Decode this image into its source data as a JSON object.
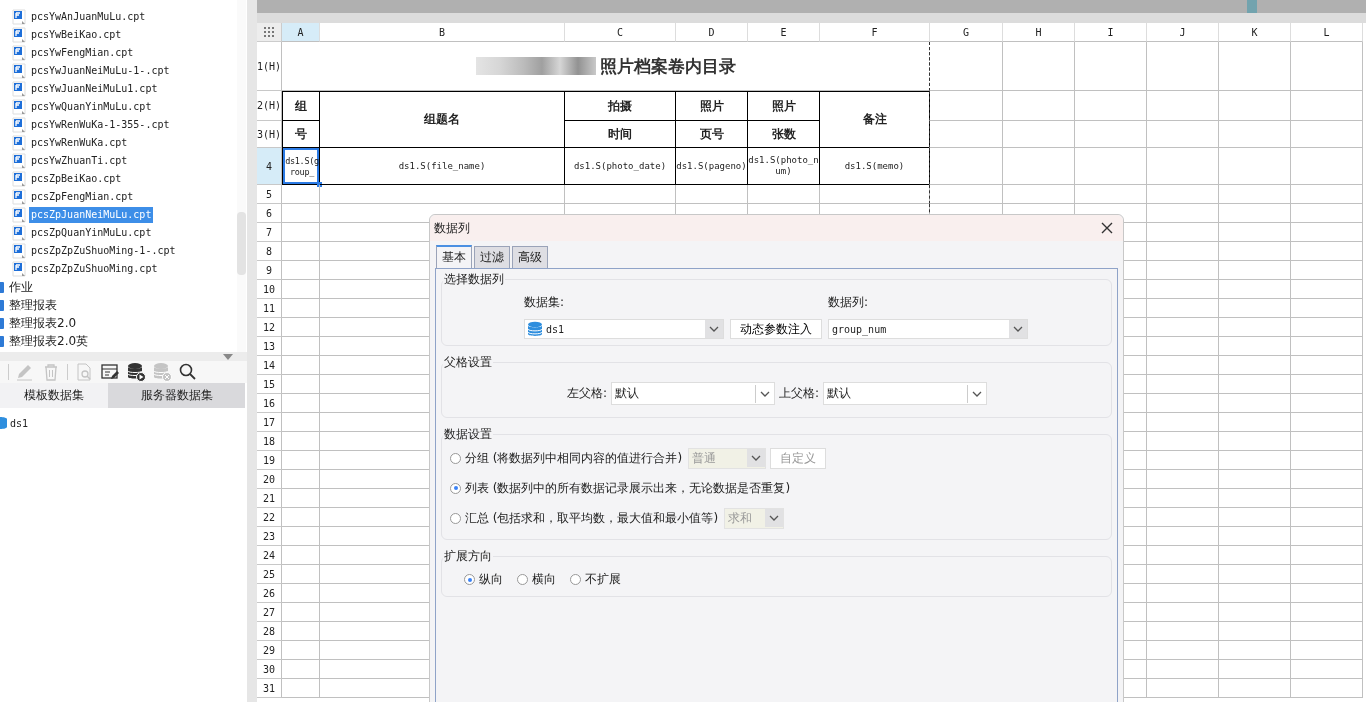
{
  "file_tree": {
    "files": [
      {
        "name": "pcsYwAnJuanMuLu.cpt",
        "selected": false
      },
      {
        "name": "pcsYwBeiKao.cpt",
        "selected": false
      },
      {
        "name": "pcsYwFengMian.cpt",
        "selected": false
      },
      {
        "name": "pcsYwJuanNeiMuLu-1-.cpt",
        "selected": false
      },
      {
        "name": "pcsYwJuanNeiMuLu1.cpt",
        "selected": false
      },
      {
        "name": "pcsYwQuanYinMuLu.cpt",
        "selected": false
      },
      {
        "name": "pcsYwRenWuKa-1-355-.cpt",
        "selected": false
      },
      {
        "name": "pcsYwRenWuKa.cpt",
        "selected": false
      },
      {
        "name": "pcsYwZhuanTi.cpt",
        "selected": false
      },
      {
        "name": "pcsZpBeiKao.cpt",
        "selected": false
      },
      {
        "name": "pcsZpFengMian.cpt",
        "selected": false
      },
      {
        "name": "pcsZpJuanNeiMuLu.cpt",
        "selected": true
      },
      {
        "name": "pcsZpQuanYinMuLu.cpt",
        "selected": false
      },
      {
        "name": "pcsZpZpZuShuoMing-1-.cpt",
        "selected": false
      },
      {
        "name": "pcsZpZpZuShuoMing.cpt",
        "selected": false
      }
    ],
    "folders": [
      {
        "name": "作业"
      },
      {
        "name": "整理报表"
      },
      {
        "name": "整理报表2.0"
      },
      {
        "name": "整理报表2.0英"
      }
    ]
  },
  "dataset_toolbar": [
    {
      "kind": "edit",
      "disabled": true
    },
    {
      "kind": "delete",
      "disabled": true
    },
    {
      "kind": "preview",
      "disabled": true
    },
    {
      "kind": "table-edit",
      "disabled": false
    },
    {
      "kind": "database-run",
      "disabled": false
    },
    {
      "kind": "database-remove",
      "disabled": true
    },
    {
      "kind": "search",
      "disabled": false
    }
  ],
  "dataset_panel": {
    "tabs": [
      {
        "label": "模板数据集",
        "selected": true
      },
      {
        "label": "服务器数据集",
        "selected": false
      }
    ],
    "datasets": [
      {
        "name": "ds1"
      }
    ]
  },
  "sheet": {
    "columns": [
      {
        "label": "A",
        "selected": true
      },
      {
        "label": "B",
        "selected": false
      },
      {
        "label": "C",
        "selected": false
      },
      {
        "label": "D",
        "selected": false
      },
      {
        "label": "E",
        "selected": false
      },
      {
        "label": "F",
        "selected": false
      },
      {
        "label": "G",
        "selected": false
      },
      {
        "label": "H",
        "selected": false
      },
      {
        "label": "I",
        "selected": false
      },
      {
        "label": "J",
        "selected": false
      },
      {
        "label": "K",
        "selected": false
      },
      {
        "label": "L",
        "selected": false
      }
    ],
    "rows": [
      {
        "label": "1(H)",
        "selected": false,
        "cells": [
          {
            "kind": "title",
            "text": "照片档案卷内目录",
            "blurred": true
          }
        ]
      },
      {
        "label": "2(H)",
        "selected": false,
        "cells": [
          {
            "kind": "header",
            "text": "组",
            "tall": false
          },
          {
            "kind": "header",
            "text": "组题名",
            "tall": true
          },
          {
            "kind": "header",
            "text": "拍摄",
            "tall": false
          },
          {
            "kind": "header",
            "text": "照片",
            "tall": false
          },
          {
            "kind": "header",
            "text": "照片",
            "tall": false
          },
          {
            "kind": "header",
            "text": "备注",
            "tall": true
          }
        ]
      },
      {
        "label": "3(H)",
        "selected": false,
        "cells": [
          {
            "kind": "header",
            "text": "号",
            "tall": false
          },
          {
            "kind": "header",
            "text": "时间",
            "tall": false
          },
          {
            "kind": "header",
            "text": "页号",
            "tall": false
          },
          {
            "kind": "header",
            "text": "张数",
            "tall": false
          }
        ]
      },
      {
        "label": "4",
        "selected": true,
        "cells": [
          {
            "kind": "field",
            "text": "ds1.S(group_",
            "selected": true
          },
          {
            "kind": "field",
            "text": "ds1.S(file_name)",
            "selected": false
          },
          {
            "kind": "field",
            "text": "ds1.S(photo_date)",
            "selected": false
          },
          {
            "kind": "field",
            "text": "ds1.S(pageno)",
            "selected": false
          },
          {
            "kind": "field",
            "text": "ds1.S(photo_num)",
            "selected": false
          },
          {
            "kind": "field",
            "text": "ds1.S(memo)",
            "selected": false
          }
        ]
      },
      {
        "label": "5",
        "selected": false
      },
      {
        "label": "6",
        "selected": false
      },
      {
        "label": "7",
        "selected": false
      },
      {
        "label": "8",
        "selected": false
      },
      {
        "label": "9",
        "selected": false
      },
      {
        "label": "10",
        "selected": false
      },
      {
        "label": "11",
        "selected": false
      },
      {
        "label": "12",
        "selected": false
      },
      {
        "label": "13",
        "selected": false
      },
      {
        "label": "14",
        "selected": false
      },
      {
        "label": "15",
        "selected": false
      },
      {
        "label": "16",
        "selected": false
      },
      {
        "label": "17",
        "selected": false
      },
      {
        "label": "18",
        "selected": false
      },
      {
        "label": "19",
        "selected": false
      },
      {
        "label": "20",
        "selected": false
      },
      {
        "label": "21",
        "selected": false
      },
      {
        "label": "22",
        "selected": false
      },
      {
        "label": "23",
        "selected": false
      },
      {
        "label": "24",
        "selected": false
      },
      {
        "label": "25",
        "selected": false
      },
      {
        "label": "26",
        "selected": false
      },
      {
        "label": "27",
        "selected": false
      },
      {
        "label": "28",
        "selected": false
      },
      {
        "label": "29",
        "selected": false
      },
      {
        "label": "30",
        "selected": false
      },
      {
        "label": "31",
        "selected": false
      }
    ]
  },
  "dialog": {
    "title": "数据列",
    "tabs": [
      {
        "label": "基本",
        "selected": true
      },
      {
        "label": "过滤",
        "selected": false
      },
      {
        "label": "高级",
        "selected": false
      }
    ],
    "select_column": {
      "legend": "选择数据列",
      "dataset_label": "数据集:",
      "dataset_value": "ds1",
      "param_button": "动态参数注入",
      "column_label": "数据列:",
      "column_value": "group_num"
    },
    "parent_cells": {
      "legend": "父格设置",
      "left_label": "左父格:",
      "left_value": "默认",
      "top_label": "上父格:",
      "top_value": "默认"
    },
    "data_setting": {
      "legend": "数据设置",
      "options": [
        {
          "label": "分组 (将数据列中相同内容的值进行合并)",
          "selected": false,
          "combo": "普通",
          "combo_disabled": true,
          "button": "自定义",
          "button_disabled": true
        },
        {
          "label": "列表 (数据列中的所有数据记录展示出来，无论数据是否重复)",
          "selected": true
        },
        {
          "label": "汇总 (包括求和，取平均数，最大值和最小值等)",
          "selected": false,
          "combo": "求和",
          "combo_disabled": true
        }
      ]
    },
    "expand": {
      "legend": "扩展方向",
      "options": [
        {
          "label": "纵向",
          "selected": true
        },
        {
          "label": "横向",
          "selected": false
        },
        {
          "label": "不扩展",
          "selected": false
        }
      ]
    }
  }
}
